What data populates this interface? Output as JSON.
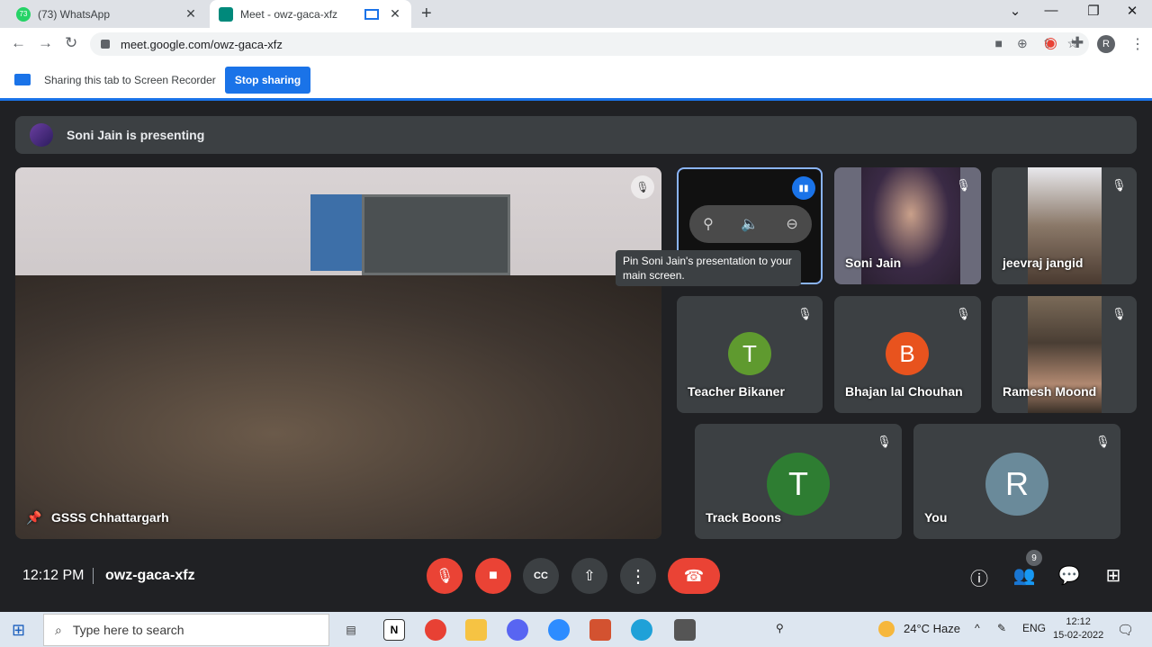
{
  "browser": {
    "tabs": [
      {
        "title": "(73) WhatsApp",
        "active": false
      },
      {
        "title": "Meet - owz-gaca-xfz",
        "active": true
      }
    ],
    "url": "meet.google.com/owz-gaca-xfz",
    "profile_initial": "R"
  },
  "share": {
    "text": "Sharing this tab to Screen Recorder",
    "stop_label": "Stop sharing"
  },
  "meet": {
    "presenting_text": "Soni Jain is presenting",
    "main_tile_name": "GSSS Chhattargarh",
    "tooltip": "Pin Soni Jain's presentation to your main screen.",
    "participants": [
      {
        "name": "Soni Jain",
        "type": "video"
      },
      {
        "name": "jeevraj jangid",
        "type": "video"
      },
      {
        "name": "Teacher Bikaner",
        "initial": "T",
        "color": "#5f9a2f"
      },
      {
        "name": "Bhajan lal Chouhan",
        "initial": "B",
        "color": "#e8531e"
      },
      {
        "name": "Ramesh Moond",
        "type": "video"
      },
      {
        "name": "Track Boons",
        "initial": "T",
        "color": "#2e7d32"
      },
      {
        "name": "You",
        "initial": "R",
        "color": "#6a8a9a"
      }
    ],
    "time": "12:12 PM",
    "meeting_code": "owz-gaca-xfz",
    "people_count": "9"
  },
  "taskbar": {
    "search_placeholder": "Type here to search",
    "weather": "24°C  Haze",
    "language": "ENG",
    "time": "12:12",
    "date": "15-02-2022"
  }
}
